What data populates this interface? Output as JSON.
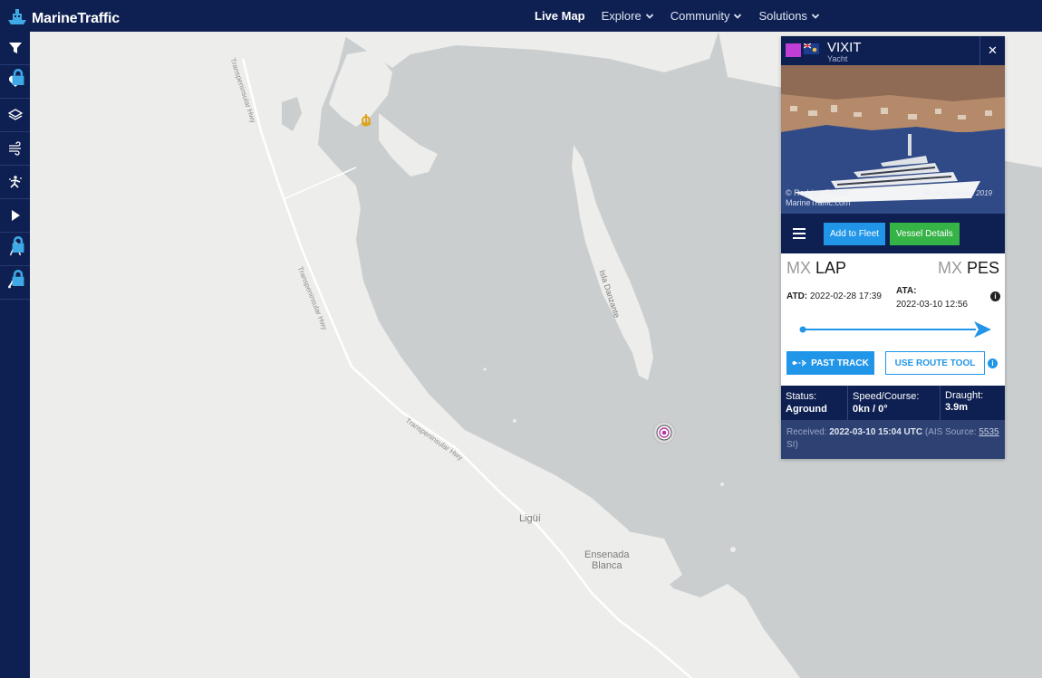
{
  "app": {
    "brand": "MarineTraffic"
  },
  "nav": {
    "items": [
      {
        "label": "Live Map",
        "active": true,
        "dropdown": false
      },
      {
        "label": "Explore",
        "active": false,
        "dropdown": true
      },
      {
        "label": "Community",
        "active": false,
        "dropdown": true
      },
      {
        "label": "Solutions",
        "active": false,
        "dropdown": true
      }
    ]
  },
  "toolbar": {
    "buttons": [
      {
        "icon": "filter-icon",
        "locked": false
      },
      {
        "icon": "heart-icon",
        "locked": true
      },
      {
        "icon": "layers-icon",
        "locked": false
      },
      {
        "icon": "wind-icon",
        "locked": false
      },
      {
        "icon": "density-icon",
        "locked": false
      },
      {
        "icon": "play-icon",
        "locked": false
      },
      {
        "icon": "measure-icon",
        "locked": true
      },
      {
        "icon": "analytics-icon",
        "locked": true
      }
    ]
  },
  "map": {
    "labels": {
      "island": "Isla Danzante",
      "road": "Transpeninsular Hwy",
      "town1": "Ligüí",
      "town2_line1": "Ensenada",
      "town2_line2": "Blanca"
    }
  },
  "vessel": {
    "name": "VIXIT",
    "type": "Yacht",
    "photo_credit_line1": "© Rodrigo Freitas",
    "photo_credit_line2": "MarineTraffic.com",
    "photo_signature": "Rodrigo Freitas 2019",
    "actions": {
      "add_fleet": "Add to Fleet",
      "details": "Vessel Details"
    },
    "route": {
      "from_cc": "MX",
      "from_port": "LAP",
      "to_cc": "MX",
      "to_port": "PES",
      "atd_label": "ATD:",
      "atd_value": "2022-02-28 17:39",
      "ata_label": "ATA:",
      "ata_value": "2022-03-10 12:56",
      "past_track": "PAST TRACK",
      "route_tool": "USE ROUTE TOOL"
    },
    "status": {
      "status_label": "Status:",
      "status_value": "Aground",
      "speed_label": "Speed/Course:",
      "speed_value": "0kn / 0°",
      "draught_label": "Draught:",
      "draught_value": "3.9m"
    },
    "received": {
      "prefix": "Received:",
      "time": "2022-03-10 15:04 UTC",
      "source_prefix": "(AIS Source:",
      "source_id": "5535",
      "source_suffix": "SI)"
    }
  },
  "colors": {
    "navy": "#0e2052",
    "blue": "#2196e8",
    "green": "#36b346",
    "water": "#cacecf",
    "land": "#ededeb"
  }
}
